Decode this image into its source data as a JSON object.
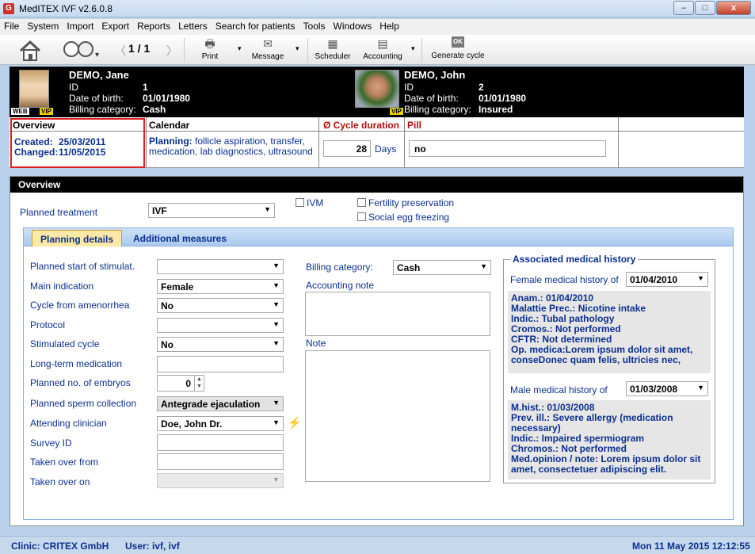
{
  "window": {
    "title": "MedITEX IVF v2.6.0.8",
    "app_icon": "G",
    "min": "–",
    "max": "□",
    "close": "x"
  },
  "menu": [
    "File",
    "System",
    "Import",
    "Export",
    "Reports",
    "Letters",
    "Search for patients",
    "Tools",
    "Windows",
    "Help"
  ],
  "toolbar": {
    "pager": "1 / 1",
    "print": "Print",
    "message": "Message",
    "scheduler": "Scheduler",
    "accounting": "Accounting",
    "ok": "OK",
    "generate": "Generate cycle"
  },
  "patient_female": {
    "name": "DEMO, Jane",
    "id_label": "ID",
    "id": "1",
    "dob_label": "Date of birth:",
    "dob": "01/01/1980",
    "billing_label": "Billing category:",
    "billing": "Cash",
    "badge_web": "WEB",
    "badge_vip": "VIP"
  },
  "patient_male": {
    "name": "DEMO, John",
    "id_label": "ID",
    "id": "2",
    "dob_label": "Date of birth:",
    "dob": "01/01/1980",
    "billing_label": "Billing category:",
    "billing": "Insured",
    "badge_vip": "VIP"
  },
  "info": {
    "overview_title": "Overview",
    "created_label": "Created:",
    "created": "25/03/2011",
    "changed_label": "Changed:",
    "changed": "11/05/2015",
    "calendar_title": "Calendar",
    "planning_label": "Planning:",
    "planning_text": "follicle aspiration, transfer, medication, lab diagnostics, ultrasound",
    "cycle_title": "Ø Cycle duration",
    "cycle_value": "28",
    "cycle_unit": "Days",
    "pill_title": "Pill",
    "pill_value": "no"
  },
  "overview": {
    "header": "Overview",
    "planned_treatment_label": "Planned treatment",
    "planned_treatment": "IVF",
    "ivm": "IVM",
    "fertility": "Fertility preservation",
    "social_egg": "Social egg freezing"
  },
  "tabs": [
    "Planning details",
    "Additional measures"
  ],
  "form": {
    "planned_start": "Planned start of stimulat.",
    "main_indication": "Main indication",
    "main_indication_val": "Female",
    "cycle_amen": "Cycle from amenorrhea",
    "cycle_amen_val": "No",
    "protocol": "Protocol",
    "stimulated": "Stimulated cycle",
    "stimulated_val": "No",
    "long_term": "Long-term medication",
    "embryos": "Planned no. of embryos",
    "embryos_val": "0",
    "sperm": "Planned sperm collection",
    "sperm_val": "Antegrade ejaculation",
    "clinician": "Attending clinician",
    "clinician_val": "Doe, John Dr.",
    "survey": "Survey ID",
    "taken_from": "Taken over from",
    "taken_on": "Taken over on",
    "billing_label": "Billing category:",
    "billing_val": "Cash",
    "acc_note": "Accounting note",
    "note": "Note"
  },
  "history": {
    "title": "Associated medical history",
    "female_label": "Female medical history of",
    "female_date": "01/04/2010",
    "female_lines": [
      "Anam.: 01/04/2010",
      "Malattie Prec.: Nicotine intake",
      "Indic.: Tubal pathology",
      "Cromos.: Not performed",
      "CFTR: Not determined",
      "Op. medica:Lorem ipsum dolor sit amet, conseDonec quam felis, ultricies nec,"
    ],
    "male_label": "Male medical history of",
    "male_date": "01/03/2008",
    "male_lines": [
      "M.hist.: 01/03/2008",
      "Prev. ill.: Severe allergy (medication necessary)",
      "Indic.: Impaired spermiogram",
      "Chromos.: Not performed",
      "Med.opinion / note: Lorem ipsum dolor sit amet, consectetuer adipiscing elit."
    ]
  },
  "status": {
    "clinic": "Clinic: CRITEX GmbH",
    "user": "User: ivf, ivf",
    "datetime": "Mon 11 May 2015 12:12:55"
  }
}
